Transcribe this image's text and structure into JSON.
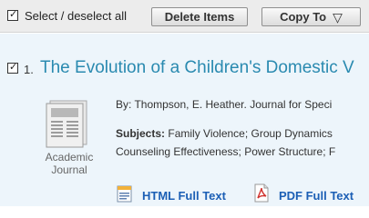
{
  "toolbar": {
    "select_label": "Select / deselect all",
    "delete_label": "Delete Items",
    "copy_label": "Copy To"
  },
  "result": {
    "number": "1.",
    "title": "The Evolution of a Children's Domestic V",
    "byline": "By: Thompson, E. Heather. Journal for Speci",
    "subjects_label": "Subjects:",
    "subjects_line1": "Family Violence; Group Dynamics",
    "subjects_line2": "Counseling Effectiveness; Power Structure; F",
    "type_line1": "Academic",
    "type_line2": "Journal",
    "html_full_text": "HTML Full Text",
    "pdf_full_text": "PDF Full Text"
  },
  "colors": {
    "title": "#2a8ab0",
    "link": "#1c5fb5",
    "result_bg": "#edf5fb",
    "toolbar_bg": "#ececec"
  }
}
